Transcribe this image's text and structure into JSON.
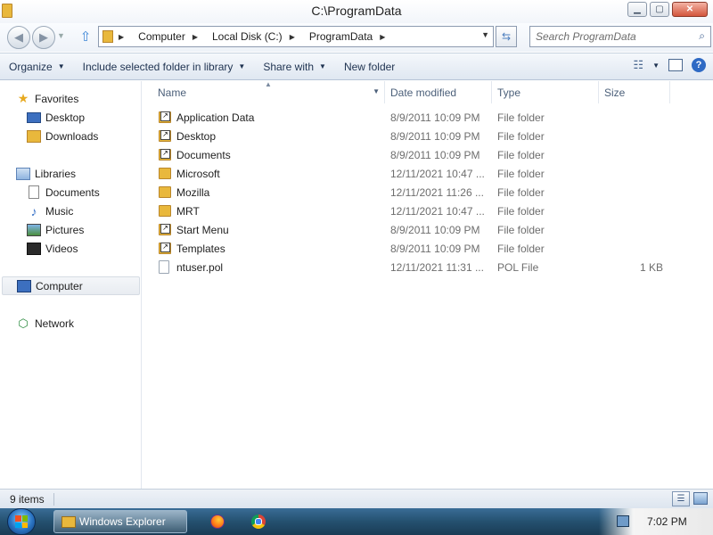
{
  "window": {
    "title": "C:\\ProgramData",
    "minimize_icon": "minimize-icon",
    "maximize_icon": "maximize-icon",
    "close_icon": "close-icon"
  },
  "address_bar": {
    "crumbs": [
      "Computer",
      "Local Disk (C:)",
      "ProgramData"
    ]
  },
  "search": {
    "placeholder": "Search ProgramData"
  },
  "toolbar": {
    "organize": "Organize",
    "include_library": "Include selected folder in library",
    "share_with": "Share with",
    "new_folder": "New folder"
  },
  "nav_pane": {
    "favorites": "Favorites",
    "desktop": "Desktop",
    "downloads": "Downloads",
    "libraries": "Libraries",
    "documents": "Documents",
    "music": "Music",
    "pictures": "Pictures",
    "videos": "Videos",
    "computer": "Computer",
    "network": "Network"
  },
  "file_list": {
    "columns": {
      "name": "Name",
      "date_modified": "Date modified",
      "type": "Type",
      "size": "Size"
    },
    "rows": [
      {
        "name": "Application Data",
        "date": "8/9/2011 10:09 PM",
        "type": "File folder",
        "size": "",
        "icon": "folder-shortcut"
      },
      {
        "name": "Desktop",
        "date": "8/9/2011 10:09 PM",
        "type": "File folder",
        "size": "",
        "icon": "folder-shortcut"
      },
      {
        "name": "Documents",
        "date": "8/9/2011 10:09 PM",
        "type": "File folder",
        "size": "",
        "icon": "folder-shortcut"
      },
      {
        "name": "Microsoft",
        "date": "12/11/2021 10:47 ...",
        "type": "File folder",
        "size": "",
        "icon": "folder"
      },
      {
        "name": "Mozilla",
        "date": "12/11/2021 11:26 ...",
        "type": "File folder",
        "size": "",
        "icon": "folder"
      },
      {
        "name": "MRT",
        "date": "12/11/2021 10:47 ...",
        "type": "File folder",
        "size": "",
        "icon": "folder"
      },
      {
        "name": "Start Menu",
        "date": "8/9/2011 10:09 PM",
        "type": "File folder",
        "size": "",
        "icon": "folder-shortcut"
      },
      {
        "name": "Templates",
        "date": "8/9/2011 10:09 PM",
        "type": "File folder",
        "size": "",
        "icon": "folder-shortcut"
      },
      {
        "name": "ntuser.pol",
        "date": "12/11/2021 11:31 ...",
        "type": "POL File",
        "size": "1 KB",
        "icon": "file"
      }
    ]
  },
  "status_bar": {
    "item_count": "9 items"
  },
  "taskbar": {
    "active_window": "Windows Explorer",
    "time": "7:02 PM"
  }
}
